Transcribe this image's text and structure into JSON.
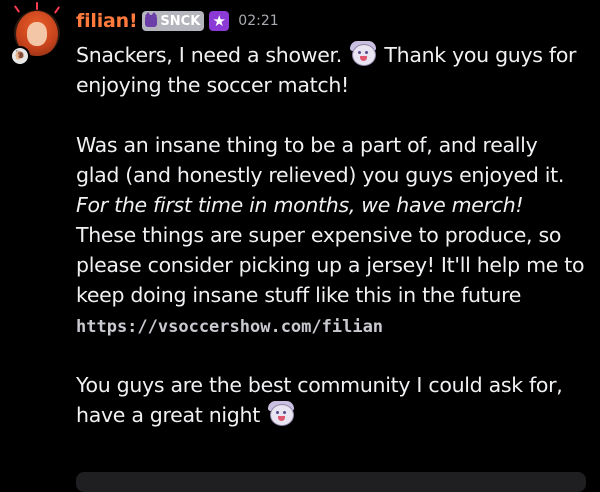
{
  "message": {
    "username": "filian!",
    "tag": "SNCK",
    "timestamp": "02:21",
    "avatar_badge": "🐌",
    "lines": {
      "l1a": "Snackers, I need a shower.",
      "l1b": "Thank you guys for",
      "l2": "enjoying the soccer match!",
      "l3": "Was an insane thing to be a part of, and really",
      "l4": "glad (and honestly relieved) you guys enjoyed it.",
      "l5": "For the first time in months, we have merch!",
      "l6": "These things are super expensive to produce, so",
      "l7": "please consider picking up a jersey! It'll help me to",
      "l8": "keep doing insane stuff like this in the future",
      "link": "https://vsoccershow.com/filian",
      "l9": "You guys are the best community I could ask for,",
      "l10": "have a great night"
    },
    "icons": {
      "tag_icon": "cat-face-icon",
      "star_badge": "star-icon",
      "emoji_1": "shower-emote-icon",
      "emoji_2": "sleepy-emote-icon"
    }
  },
  "colors": {
    "background": "#000000",
    "username": "#ff7a3d",
    "text": "#f0f1f3",
    "timestamp": "#a9abb2",
    "tag_bg": "#b5b5bd",
    "star_badge": "#8c3ad6"
  }
}
